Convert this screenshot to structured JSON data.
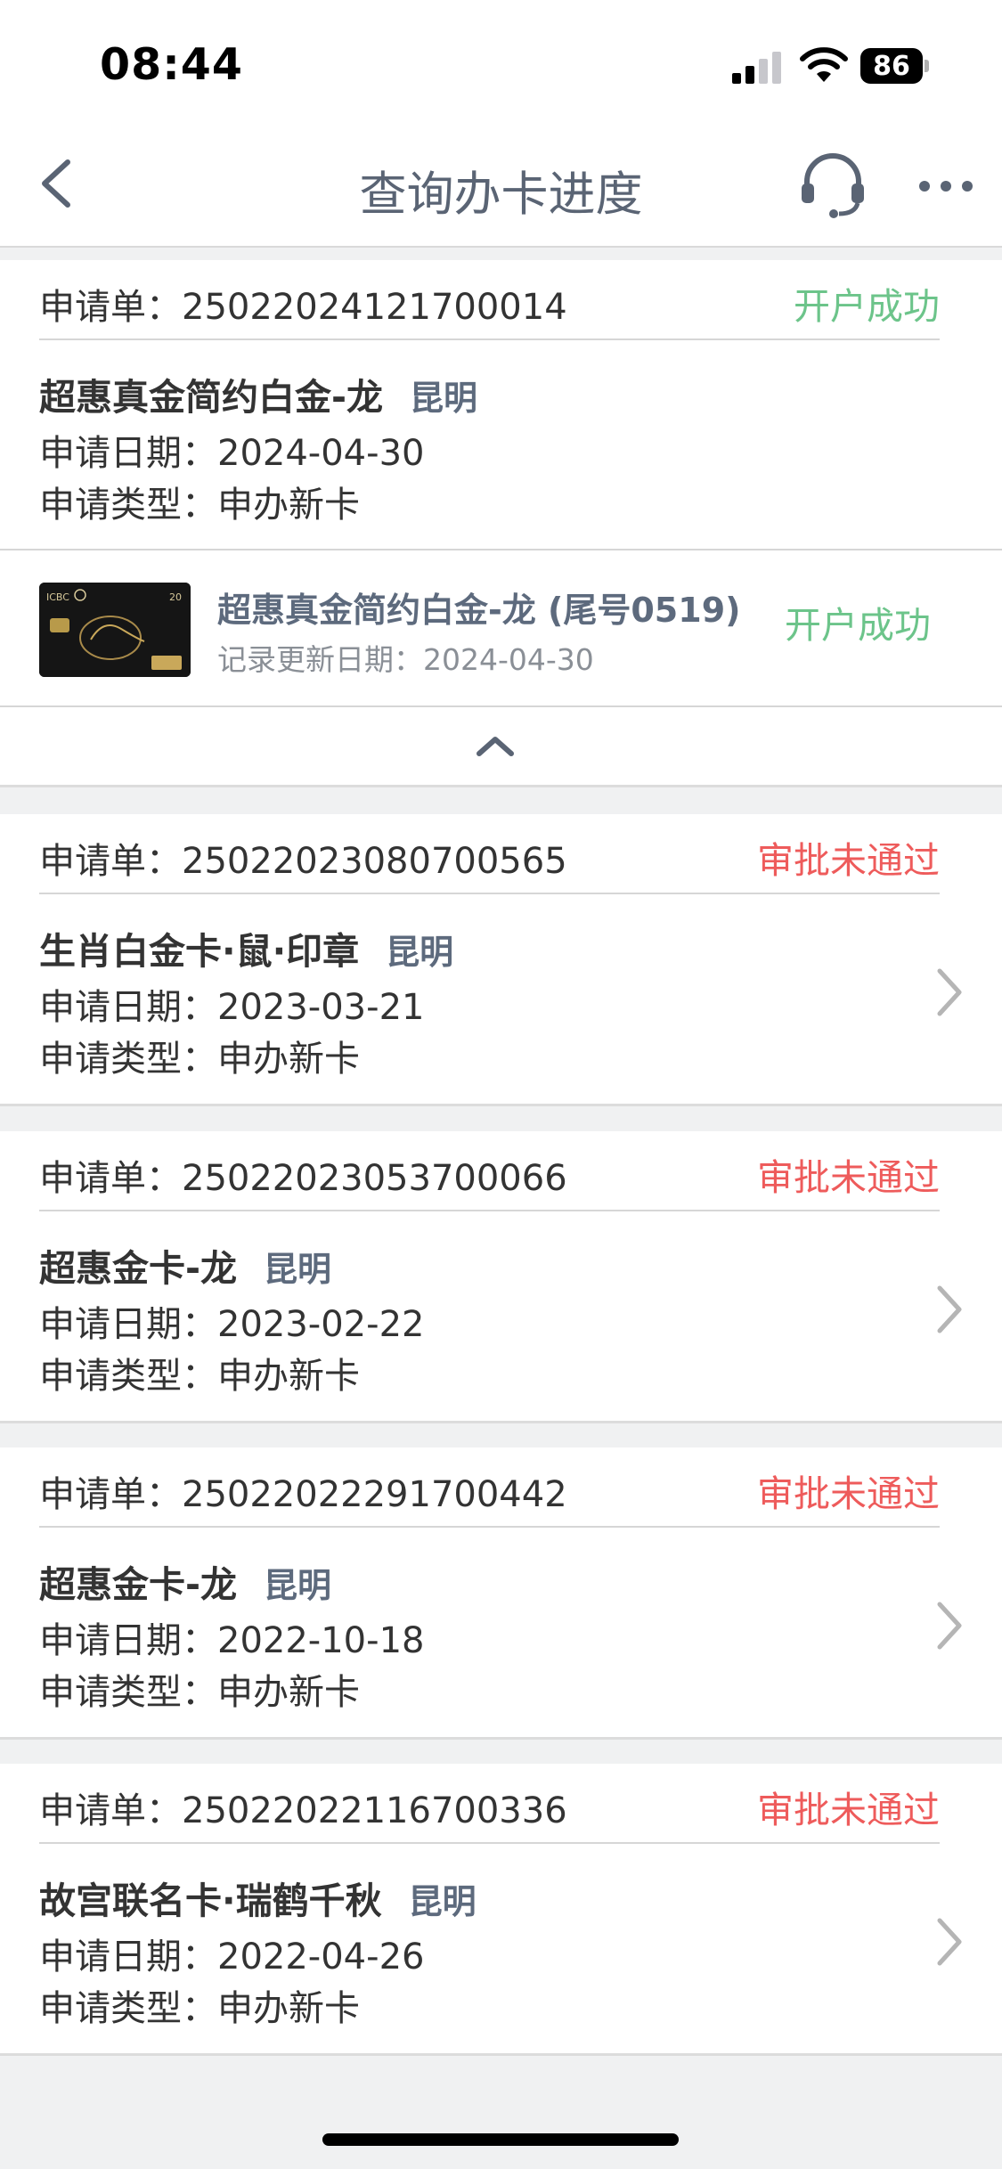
{
  "status_bar": {
    "time": "08:44",
    "battery": "86"
  },
  "header": {
    "title": "查询办卡进度"
  },
  "labels": {
    "app_no": "申请单：",
    "date": "申请日期：",
    "type": "申请类型：",
    "record_date": "记录更新日期："
  },
  "applications": [
    {
      "number": "25022024121700014",
      "status": "开户成功",
      "card_name": "超惠真金简约白金-龙",
      "city": "昆明",
      "date": "2024-04-30",
      "type": "申办新卡",
      "expanded": true,
      "detail": {
        "card_name": "超惠真金简约白金-龙 (尾号0519)",
        "record_date": "2024-04-30",
        "status": "开户成功",
        "thumb_brand": "ICBC"
      }
    },
    {
      "number": "25022023080700565",
      "status": "审批未通过",
      "card_name": "生肖白金卡·鼠·印章",
      "city": "昆明",
      "date": "2023-03-21",
      "type": "申办新卡"
    },
    {
      "number": "25022023053700066",
      "status": "审批未通过",
      "card_name": "超惠金卡-龙",
      "city": "昆明",
      "date": "2023-02-22",
      "type": "申办新卡"
    },
    {
      "number": "25022022291700442",
      "status": "审批未通过",
      "card_name": "超惠金卡-龙",
      "city": "昆明",
      "date": "2022-10-18",
      "type": "申办新卡"
    },
    {
      "number": "25022022116700336",
      "status": "审批未通过",
      "card_name": "故宫联名卡·瑞鹤千秋",
      "city": "昆明",
      "date": "2022-04-26",
      "type": "申办新卡"
    }
  ],
  "icons": {
    "back": "back-arrow-icon",
    "headset": "headset-icon",
    "more": "more-icon",
    "collapse": "chevron-up-icon",
    "row": "chevron-right-icon"
  },
  "colors": {
    "success": "#6cc48a",
    "fail": "#ee5b5b",
    "accent": "#5a6474"
  }
}
